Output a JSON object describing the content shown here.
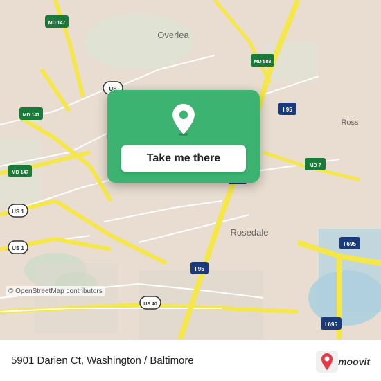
{
  "map": {
    "background_color": "#e8ddd0",
    "road_color_highway": "#f5e74a",
    "road_color_interstate": "#f5e74a",
    "road_color_minor": "#ffffff",
    "water_color": "#b8d4e8"
  },
  "location_card": {
    "button_label": "Take me there",
    "background_color": "#3cb371",
    "pin_color": "#ffffff"
  },
  "bottom_bar": {
    "address": "5901 Darien Ct, Washington / Baltimore",
    "logo_text": "moovit"
  },
  "osm_credit": "© OpenStreetMap contributors",
  "road_labels": [
    "MD 147",
    "MD 147",
    "MD 147",
    "US 1",
    "US 1",
    "I 95",
    "I 95",
    "I 95",
    "MD 588",
    "MD 7",
    "US 40",
    "I 695",
    "I 695"
  ],
  "place_labels": [
    "Overlea",
    "Rosedale",
    "Ross"
  ]
}
